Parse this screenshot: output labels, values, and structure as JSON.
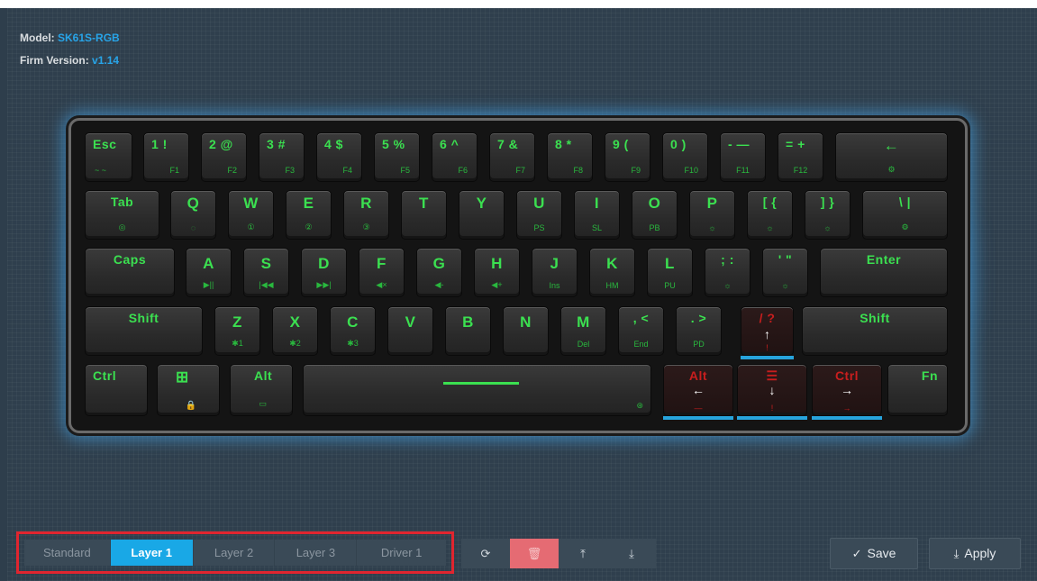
{
  "device": {
    "model_label": "Model:",
    "model_value": "SK61S-RGB",
    "firmware_label": "Firm Version:",
    "firmware_value": "v1.14"
  },
  "keyboard": {
    "row1": [
      {
        "main": "Esc",
        "sub": "~ ~"
      },
      {
        "main": "1 !",
        "sub": "F1"
      },
      {
        "main": "2 @",
        "sub": "F2"
      },
      {
        "main": "3 #",
        "sub": "F3"
      },
      {
        "main": "4 $",
        "sub": "F4"
      },
      {
        "main": "5 %",
        "sub": "F5"
      },
      {
        "main": "6 ^",
        "sub": "F6"
      },
      {
        "main": "7 &",
        "sub": "F7"
      },
      {
        "main": "8 *",
        "sub": "F8"
      },
      {
        "main": "9 (",
        "sub": "F9"
      },
      {
        "main": "0 )",
        "sub": "F10"
      },
      {
        "main": "- —",
        "sub": "F11"
      },
      {
        "main": "= +",
        "sub": "F12"
      },
      {
        "main": "←",
        "sub": "⚙"
      }
    ],
    "row2": [
      {
        "main": "Tab",
        "sub": "◎"
      },
      {
        "main": "Q",
        "sub": "◌"
      },
      {
        "main": "W",
        "sub": "①"
      },
      {
        "main": "E",
        "sub": "②"
      },
      {
        "main": "R",
        "sub": "③"
      },
      {
        "main": "T",
        "sub": ""
      },
      {
        "main": "Y",
        "sub": ""
      },
      {
        "main": "U",
        "sub": "PS"
      },
      {
        "main": "I",
        "sub": "SL"
      },
      {
        "main": "O",
        "sub": "PB"
      },
      {
        "main": "P",
        "sub": "☼"
      },
      {
        "main": "[ {",
        "sub": "☼"
      },
      {
        "main": "] }",
        "sub": "☼"
      },
      {
        "main": "\\ |",
        "sub": "⚙"
      }
    ],
    "row3": [
      {
        "main": "Caps",
        "sub": ""
      },
      {
        "main": "A",
        "sub": "▶||"
      },
      {
        "main": "S",
        "sub": "|◀◀"
      },
      {
        "main": "D",
        "sub": "▶▶|"
      },
      {
        "main": "F",
        "sub": "◀×"
      },
      {
        "main": "G",
        "sub": "◀-"
      },
      {
        "main": "H",
        "sub": "◀+"
      },
      {
        "main": "J",
        "sub": "Ins"
      },
      {
        "main": "K",
        "sub": "HM"
      },
      {
        "main": "L",
        "sub": "PU"
      },
      {
        "main": "; :",
        "sub": "☼"
      },
      {
        "main": "' \"",
        "sub": "☼"
      },
      {
        "main": "Enter",
        "sub": ""
      }
    ],
    "row4": [
      {
        "main": "Shift",
        "sub": ""
      },
      {
        "main": "Z",
        "sub": "✱1"
      },
      {
        "main": "X",
        "sub": "✱2"
      },
      {
        "main": "C",
        "sub": "✱3"
      },
      {
        "main": "V",
        "sub": ""
      },
      {
        "main": "B",
        "sub": ""
      },
      {
        "main": "N",
        "sub": ""
      },
      {
        "main": "M",
        "sub": "Del"
      },
      {
        "main": ", <",
        "sub": "End"
      },
      {
        "main": ". >",
        "sub": "PD"
      },
      {
        "main": "/ ?",
        "sub": "!",
        "arrow": "↑"
      },
      {
        "main": "Shift",
        "sub": ""
      }
    ],
    "row5": [
      {
        "main": "Ctrl",
        "sub": ""
      },
      {
        "main": "⊞",
        "sub": "🔒"
      },
      {
        "main": "Alt",
        "sub": "▭"
      },
      {
        "main": "",
        "sub": "⊛"
      },
      {
        "main": "Alt",
        "sub": "—",
        "arrow": "←"
      },
      {
        "main": "☰",
        "sub": "!",
        "arrow": "↓"
      },
      {
        "main": "Ctrl",
        "sub": "→",
        "arrow": "→"
      },
      {
        "main": "Fn",
        "sub": ""
      }
    ]
  },
  "layers": {
    "tabs": [
      "Standard",
      "Layer 1",
      "Layer 2",
      "Layer 3",
      "Driver 1"
    ],
    "active": "Layer 1"
  },
  "tools": {
    "reset_icon": "refresh-icon",
    "delete_icon": "trash-icon",
    "export_icon": "upload-icon",
    "import_icon": "download-icon"
  },
  "actions": {
    "save_label": "Save",
    "apply_label": "Apply"
  },
  "colors": {
    "accent": "#19a8e6",
    "key_text": "#3be050",
    "remap_text": "#c81e1e",
    "highlight_box": "#e0252f"
  }
}
